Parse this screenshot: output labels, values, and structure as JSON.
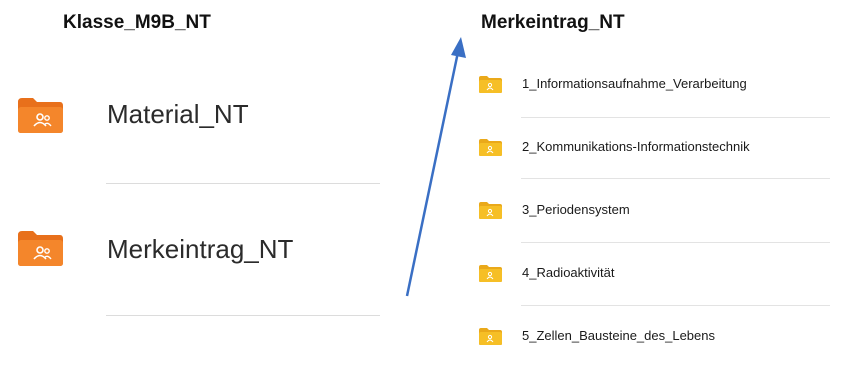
{
  "left_panel": {
    "title": "Klasse_M9B_NT",
    "folders": [
      {
        "label": "Material_NT",
        "icon": "shared-folder-icon"
      },
      {
        "label": "Merkeintrag_NT",
        "icon": "shared-folder-icon"
      }
    ]
  },
  "right_panel": {
    "title": "Merkeintrag_NT",
    "folders": [
      {
        "label": "1_Informationsaufnahme_Verarbeitung",
        "icon": "shared-folder-icon"
      },
      {
        "label": "2_Kommunikations-Informationstechnik",
        "icon": "shared-folder-icon"
      },
      {
        "label": "3_Periodensystem",
        "icon": "shared-folder-icon"
      },
      {
        "label": "4_Radioaktivität",
        "icon": "shared-folder-icon"
      },
      {
        "label": "5_Zellen_Bausteine_des_Lebens",
        "icon": "shared-folder-icon"
      }
    ]
  },
  "colors": {
    "folder_orange": "#f07a1f",
    "folder_yellow": "#f6bf26",
    "arrow_blue": "#3a6fc4"
  }
}
